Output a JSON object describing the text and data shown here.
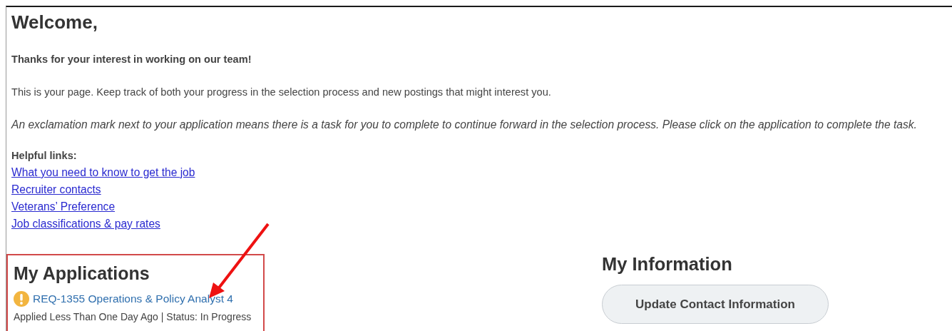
{
  "welcome": {
    "title": "Welcome,",
    "paragraphs": [
      {
        "text": "Thanks for your interest in working on our team!",
        "kind": "lead"
      },
      {
        "text": "This is your page. Keep track of both your progress in the selection process and new postings that might interest you.",
        "kind": "body"
      },
      {
        "text": "An exclamation mark next to your application means there is a task for you to complete to continue forward in the selection process. Please click on the application to complete the task.",
        "kind": "note"
      }
    ],
    "links_heading": "Helpful links:",
    "links": [
      "What you need to know to get the job",
      "Recruiter contacts",
      "Veterans’ Preference",
      "Job classifications & pay rates"
    ]
  },
  "my_applications": {
    "title": "My Applications",
    "highlighted": true,
    "applications": [
      {
        "title": "REQ-1355 Operations & Policy Analyst 4",
        "task_pending": true,
        "details": "Applied Less Than One Day Ago | Status: In Progress"
      }
    ]
  },
  "my_information": {
    "title": "My Information",
    "buttons": [
      "Update Contact Information"
    ]
  }
}
